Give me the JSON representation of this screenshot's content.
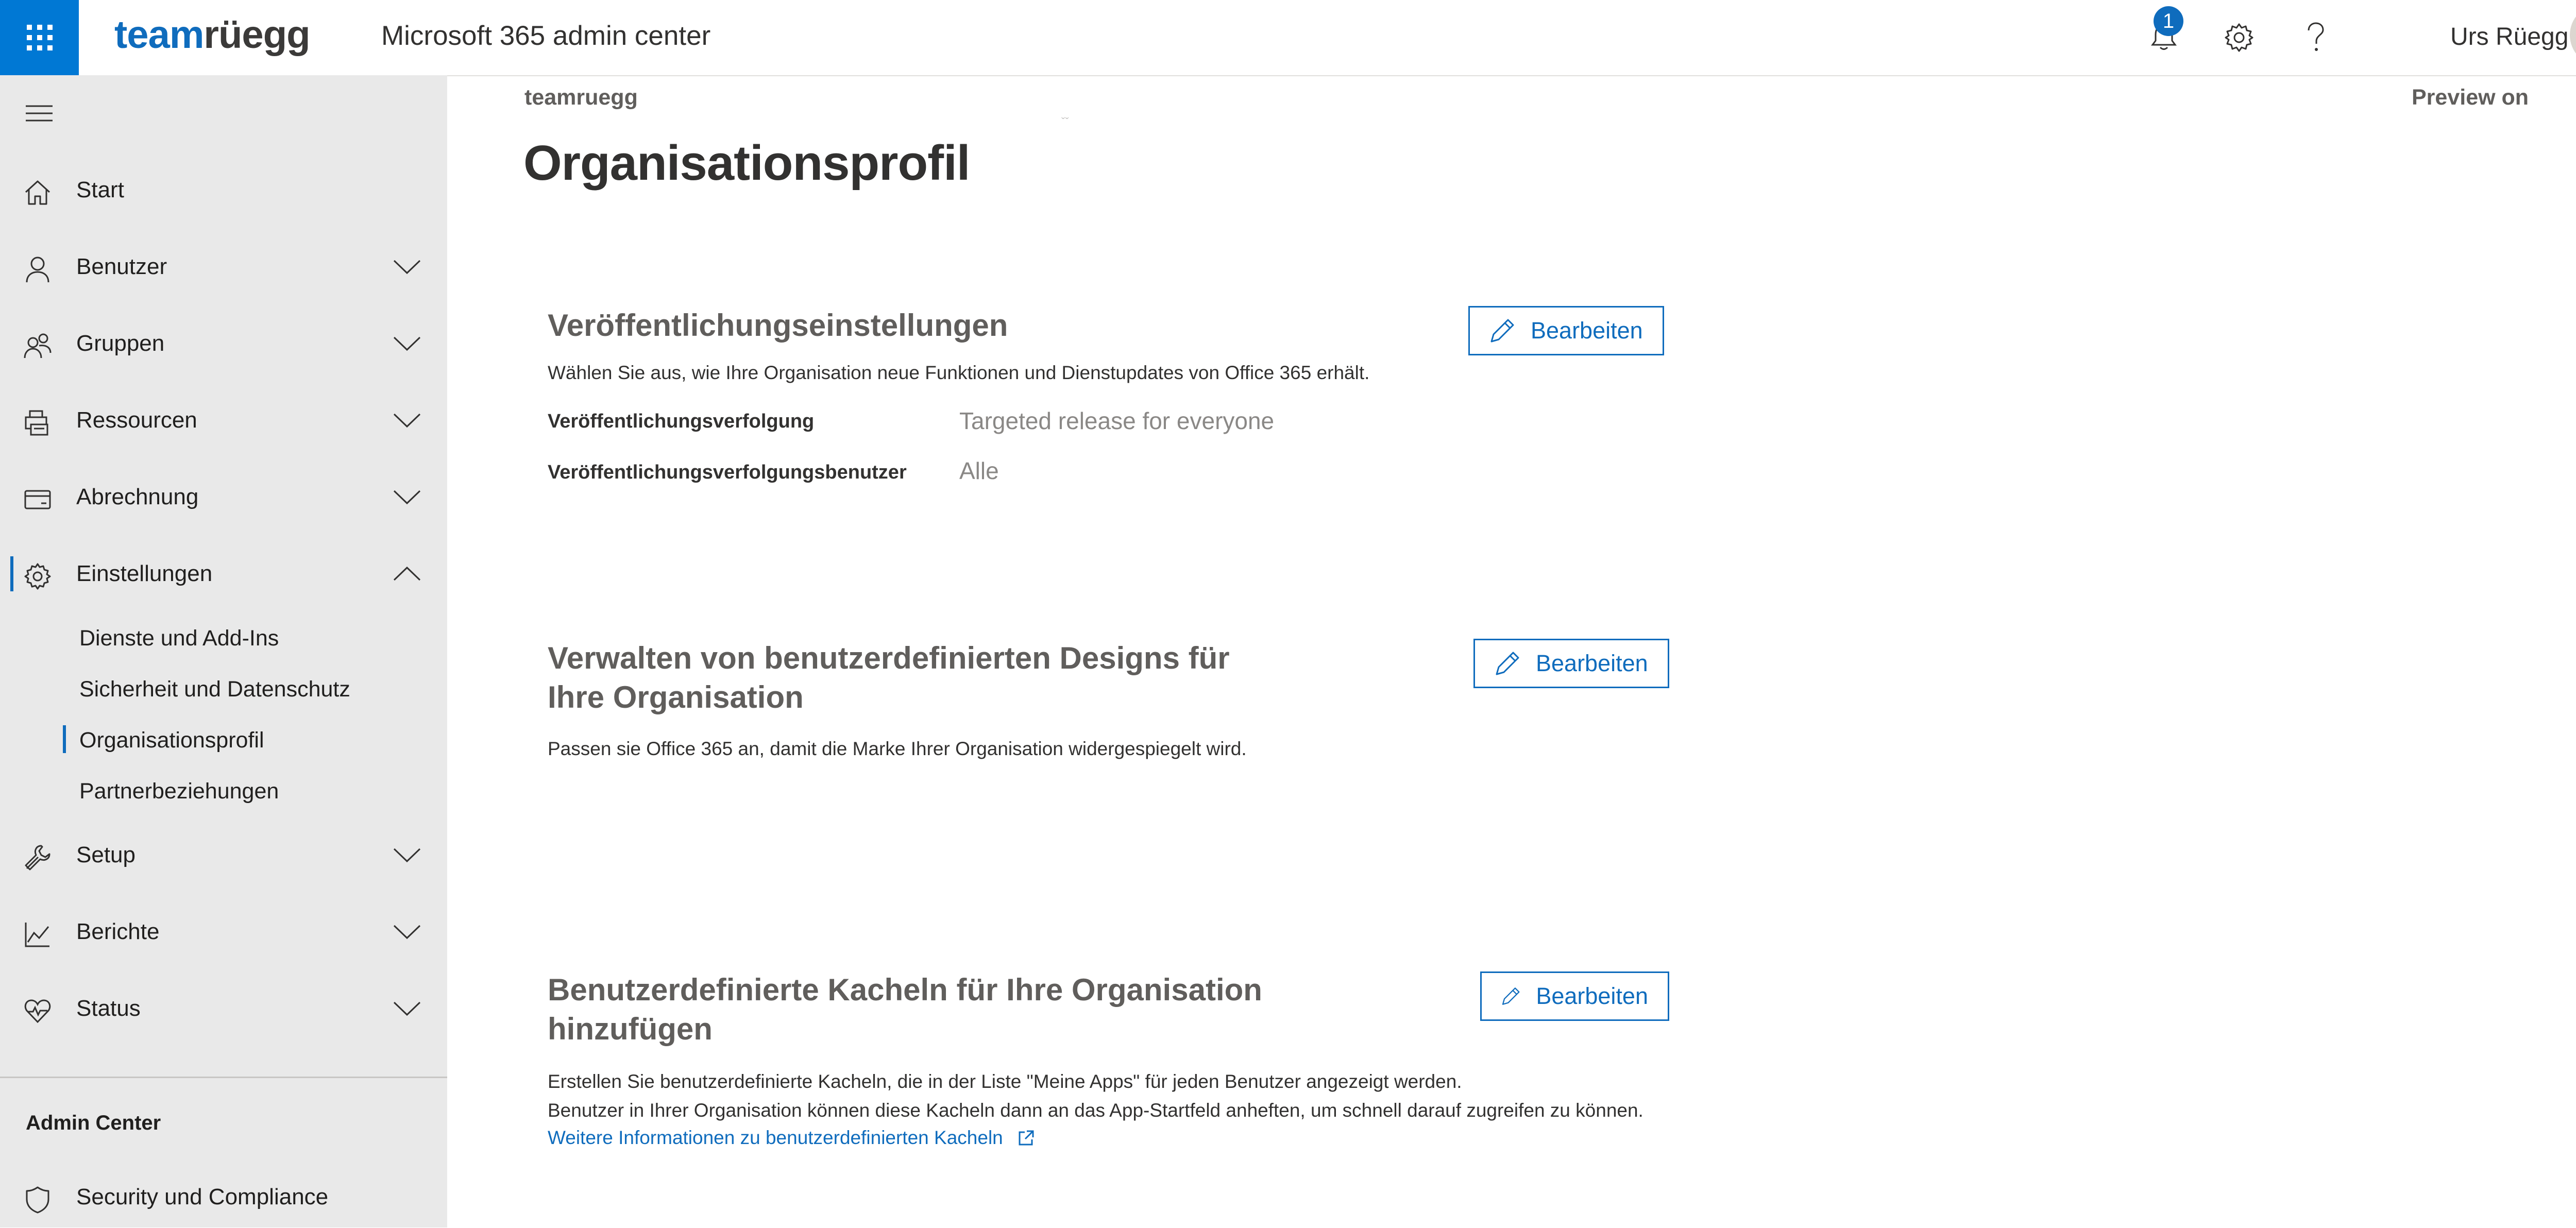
{
  "header": {
    "brand_part1": "team",
    "brand_part2": "rüegg",
    "app_title": "Microsoft 365 admin center",
    "notification_count": "1",
    "user_name": "Urs Rüegg"
  },
  "sidebar": {
    "items": [
      {
        "label": "Start",
        "icon": "home-icon"
      },
      {
        "label": "Benutzer",
        "icon": "person-icon"
      },
      {
        "label": "Gruppen",
        "icon": "people-icon"
      },
      {
        "label": "Ressourcen",
        "icon": "printer-icon"
      },
      {
        "label": "Abrechnung",
        "icon": "card-icon"
      },
      {
        "label": "Einstellungen",
        "icon": "gear-icon"
      },
      {
        "label": "Setup",
        "icon": "wrench-icon"
      },
      {
        "label": "Berichte",
        "icon": "chart-icon"
      },
      {
        "label": "Status",
        "icon": "heart-icon"
      }
    ],
    "settings_sub": [
      {
        "label": "Dienste und Add-Ins"
      },
      {
        "label": "Sicherheit und Datenschutz"
      },
      {
        "label": "Organisationsprofil"
      },
      {
        "label": "Partnerbeziehungen"
      }
    ],
    "admin_center_heading": "Admin Center",
    "security_label": "Security und Compliance"
  },
  "main": {
    "breadcrumb": "teamruegg",
    "preview": "Preview on",
    "title": "Organisationsprofil",
    "sections": [
      {
        "title": "Veröffentlichungseinstellungen",
        "desc": "Wählen Sie aus, wie Ihre Organisation neue Funktionen und Dienstupdates von Office 365 erhält.",
        "props": [
          {
            "label": "Veröffentlichungsverfolgung",
            "value": "Targeted release for everyone"
          },
          {
            "label": "Veröffentlichungsverfolgungsbenutzer",
            "value": "Alle"
          }
        ],
        "button": "Bearbeiten"
      },
      {
        "title_line1": "Verwalten von benutzerdefinierten Designs für",
        "title_line2": "Ihre Organisation",
        "desc": "Passen sie Office 365 an, damit die Marke Ihrer Organisation widergespiegelt wird.",
        "button": "Bearbeiten"
      },
      {
        "title_line1": "Benutzerdefinierte Kacheln für Ihre Organisation",
        "title_line2": "hinzufügen",
        "desc_line1": "Erstellen Sie benutzerdefinierte Kacheln, die in der Liste \"Meine Apps\" für jeden Benutzer angezeigt werden.",
        "desc_line2": "Benutzer in Ihrer Organisation können diese Kacheln dann an das App-Startfeld anheften, um schnell darauf zugreifen zu können.",
        "link": "Weitere Informationen zu benutzerdefinierten Kacheln",
        "button": "Bearbeiten"
      }
    ]
  },
  "colors": {
    "accent": "#0f6cbd",
    "waffle_bg": "#0078d4",
    "sidebar_bg": "#e9e9e9"
  }
}
